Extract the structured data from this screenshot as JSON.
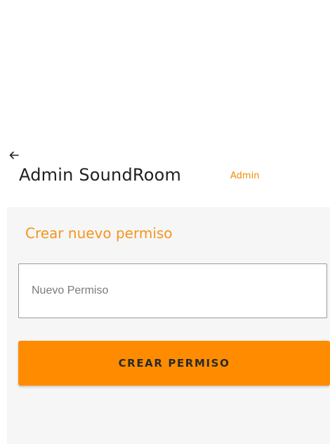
{
  "header": {
    "back_icon": "arrow-left-icon",
    "title": "Admin SoundRoom",
    "role": "Admin"
  },
  "form": {
    "heading": "Crear nuevo permiso",
    "input_placeholder": "Nuevo Permiso",
    "input_value": "",
    "submit_label": "CREAR PERMISO"
  },
  "colors": {
    "accent": "#ff8c00",
    "heading": "#f5951f",
    "role_text": "#f08a00",
    "panel_bg": "#f6f6f6"
  }
}
